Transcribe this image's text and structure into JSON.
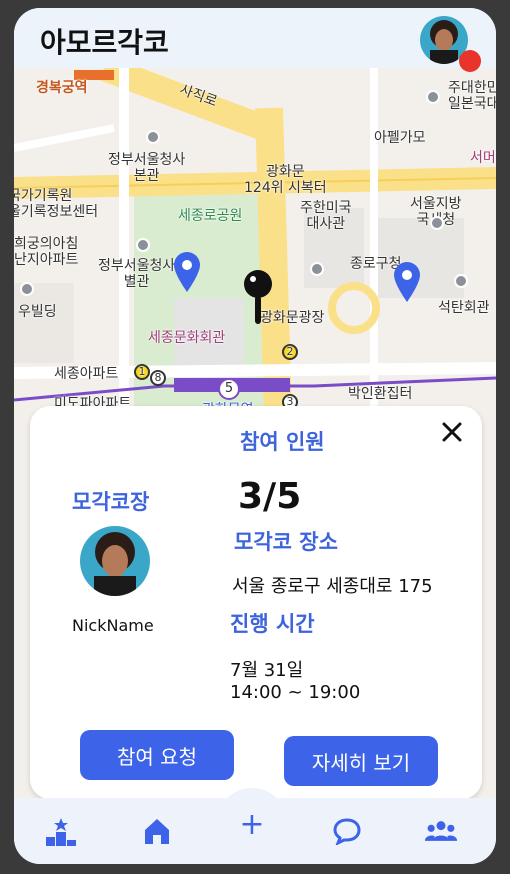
{
  "header": {
    "app_title": "아모르각코"
  },
  "map": {
    "labels": {
      "gyeongbokgung": "경복궁역",
      "sajikro": "사직로",
      "jongdae": "주대한민\n일본국대",
      "apelgamo": "아펠가모",
      "seomun": "서머",
      "govt_complex": "정부서울청사\n본관",
      "gwanghwamun_market": "광화문\n124위 시복터",
      "archives": "국가기록원\n울기록정보센터",
      "sejong_park": "세종로공원",
      "us_embassy": "주한미국\n대사관",
      "seoul_agency": "서울지방\n국세청",
      "heegung": "희궁의아침\n난지아파트",
      "govt_annex": "정부서울청사\n별관",
      "jongno_office": "종로구청",
      "seokhyeon": "석탄회관",
      "u_building": "우빌딩",
      "sejong_center": "세종문화회관",
      "gwanghwamun_square": "광화문광장",
      "sejong_apt": "세종아파트",
      "park_hwan": "박인환집터",
      "mido_apt": "미도파아파트",
      "gwanghwamun_station": "광화문역",
      "badge_1": "1",
      "badge_8": "8",
      "badge_5": "5",
      "badge_2": "2",
      "badge_3": "3"
    }
  },
  "card": {
    "participants_label": "참여 인원",
    "participants_count": "3/5",
    "leader_label": "모각코장",
    "nickname": "NickName",
    "place_label": "모각코 장소",
    "place_value": "서울 종로구 세종대로 175",
    "time_label": "진행 시간",
    "date_value": "7월 31일",
    "time_value": "14:00 ~ 19:00",
    "join_button": "참여 요청",
    "detail_button": "자세히 보기"
  },
  "nav": {
    "fab_symbol": "+",
    "items": [
      "ranking-icon",
      "home-icon",
      "chat-icon",
      "group-icon"
    ]
  },
  "colors": {
    "accent": "#3d63e8",
    "pin": "#3d63e8",
    "notify": "#e8342a"
  }
}
